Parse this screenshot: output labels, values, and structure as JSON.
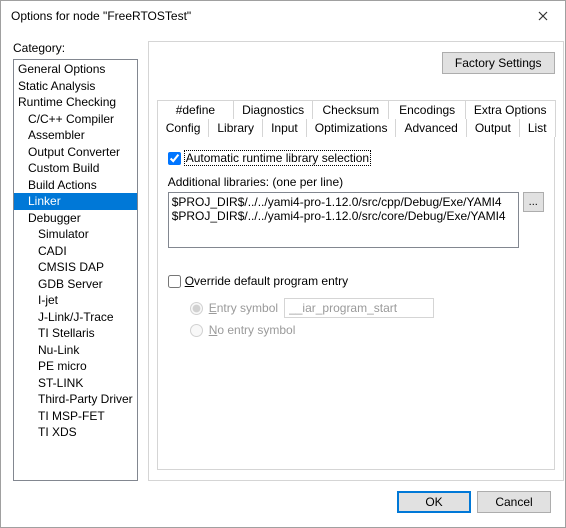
{
  "window": {
    "title": "Options for node \"FreeRTOSTest\""
  },
  "category_label": "Category:",
  "categories": [
    {
      "label": "General Options",
      "indent": 0
    },
    {
      "label": "Static Analysis",
      "indent": 0
    },
    {
      "label": "Runtime Checking",
      "indent": 0
    },
    {
      "label": "C/C++ Compiler",
      "indent": 1
    },
    {
      "label": "Assembler",
      "indent": 1
    },
    {
      "label": "Output Converter",
      "indent": 1
    },
    {
      "label": "Custom Build",
      "indent": 1
    },
    {
      "label": "Build Actions",
      "indent": 1
    },
    {
      "label": "Linker",
      "indent": 1,
      "selected": true
    },
    {
      "label": "Debugger",
      "indent": 1
    },
    {
      "label": "Simulator",
      "indent": 2
    },
    {
      "label": "CADI",
      "indent": 2
    },
    {
      "label": "CMSIS DAP",
      "indent": 2
    },
    {
      "label": "GDB Server",
      "indent": 2
    },
    {
      "label": "I-jet",
      "indent": 2
    },
    {
      "label": "J-Link/J-Trace",
      "indent": 2
    },
    {
      "label": "TI Stellaris",
      "indent": 2
    },
    {
      "label": "Nu-Link",
      "indent": 2
    },
    {
      "label": "PE micro",
      "indent": 2
    },
    {
      "label": "ST-LINK",
      "indent": 2
    },
    {
      "label": "Third-Party Driver",
      "indent": 2
    },
    {
      "label": "TI MSP-FET",
      "indent": 2
    },
    {
      "label": "TI XDS",
      "indent": 2
    }
  ],
  "factory_button": "Factory Settings",
  "tabs_row1": [
    "#define",
    "Diagnostics",
    "Checksum",
    "Encodings",
    "Extra Options"
  ],
  "tabs_row2": [
    "Config",
    "Library",
    "Input",
    "Optimizations",
    "Advanced",
    "Output",
    "List"
  ],
  "selected_tab": "Library",
  "panel": {
    "auto_runtime_label": "Automatic runtime library selection",
    "auto_runtime_checked": true,
    "additional_label": "Additional libraries: (one per line)",
    "additional_value": "$PROJ_DIR$/../../yami4-pro-1.12.0/src/cpp/Debug/Exe/YAMI4\n$PROJ_DIR$/../../yami4-pro-1.12.0/src/core/Debug/Exe/YAMI4",
    "browse_label": "...",
    "override_label": "verride default program entry",
    "override_prefix": "O",
    "override_checked": false,
    "entry_symbol_prefix": "E",
    "entry_symbol_label": "ntry symbol",
    "entry_symbol_value": "__iar_program_start",
    "no_entry_prefix": "N",
    "no_entry_label": "o entry symbol"
  },
  "footer": {
    "ok": "OK",
    "cancel": "Cancel"
  }
}
